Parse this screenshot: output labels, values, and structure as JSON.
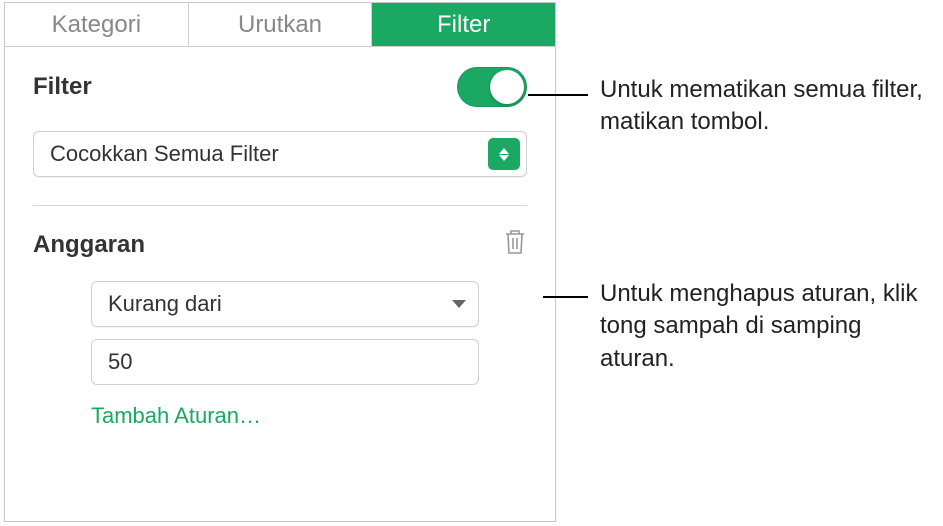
{
  "tabs": {
    "category": "Kategori",
    "sort": "Urutkan",
    "filter": "Filter"
  },
  "filter": {
    "label": "Filter",
    "match_mode": "Cocokkan Semua Filter"
  },
  "rule": {
    "column": "Anggaran",
    "condition": "Kurang dari",
    "value": "50",
    "add_rule": "Tambah Aturan…"
  },
  "callouts": {
    "toggle": "Untuk mematikan semua filter, matikan tombol.",
    "trash": "Untuk menghapus aturan, klik tong sampah di samping aturan."
  }
}
